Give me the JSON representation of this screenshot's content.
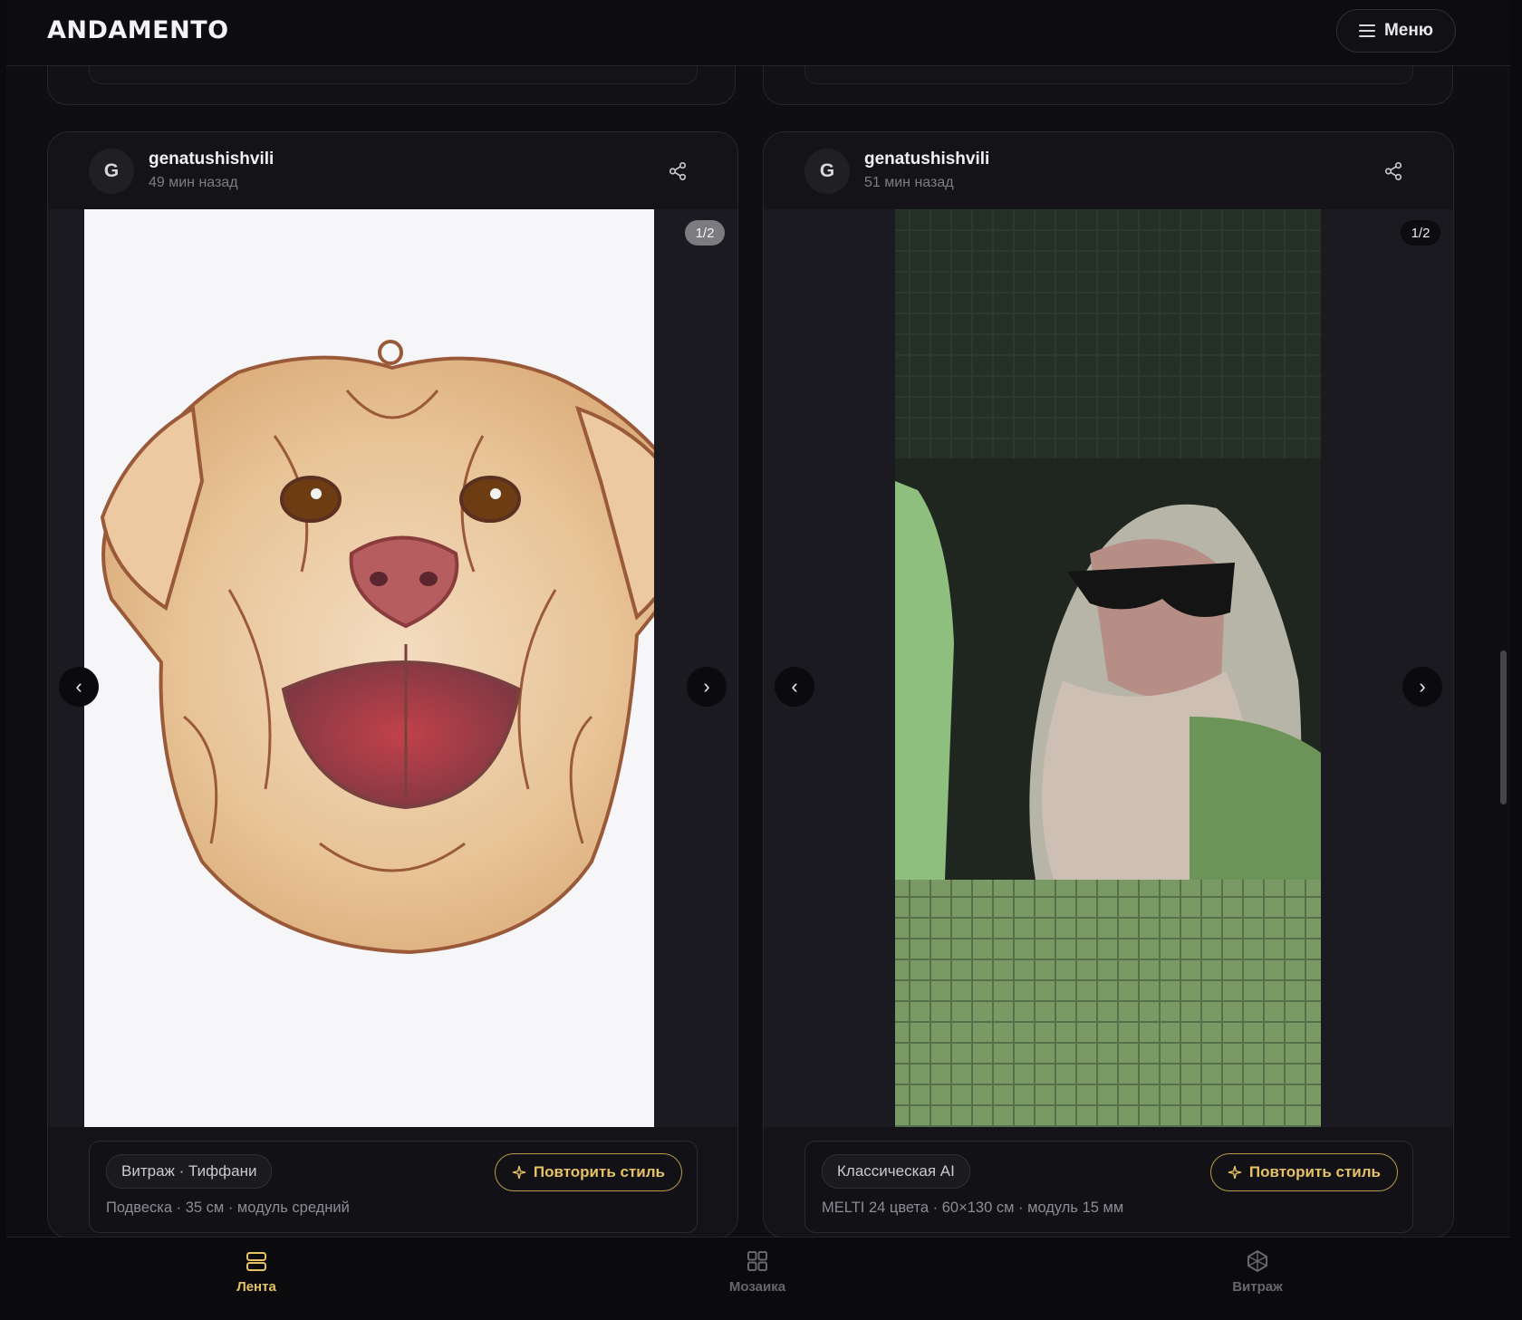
{
  "app": {
    "logo": "ANDAMENTO",
    "menu_label": "Меню"
  },
  "posts": [
    {
      "avatar_letter": "G",
      "username": "genatushishvili",
      "time": "49 мин назад",
      "counter": "1/2",
      "image_subject": "stained-glass-dog",
      "tag": "Витраж · Тиффани",
      "repeat_label": "Повторить стиль",
      "details": "Подвеска · 35 см · модуль средний"
    },
    {
      "avatar_letter": "G",
      "username": "genatushishvili",
      "time": "51 мин назад",
      "counter": "1/2",
      "image_subject": "mosaic-bearded-man",
      "tag": "Классическая AI",
      "repeat_label": "Повторить стиль",
      "details": "MELTI 24 цвета · 60×130 см · модуль 15 мм"
    }
  ],
  "bottom_nav": [
    {
      "label": "Лента",
      "icon": "feed-icon",
      "active": true
    },
    {
      "label": "Мозаика",
      "icon": "grid-icon",
      "active": false
    },
    {
      "label": "Витраж",
      "icon": "stained-glass-icon",
      "active": false
    }
  ],
  "colors": {
    "accent": "#e6c265",
    "background": "#0f0f12",
    "card": "#141418"
  }
}
